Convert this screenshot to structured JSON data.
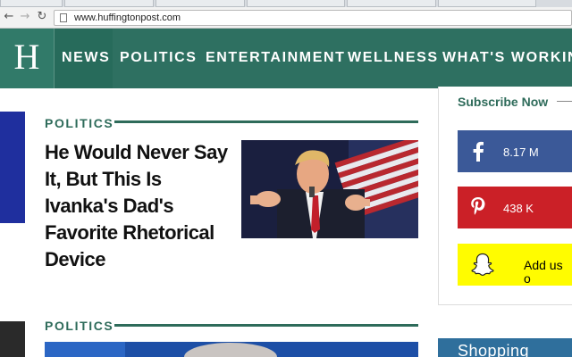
{
  "browser": {
    "url": "www.huffingtonpost.com",
    "back_icon": "arrow-left",
    "forward_icon": "arrow-right",
    "reload_icon": "reload"
  },
  "site": {
    "logo": "H",
    "nav": [
      "NEWS",
      "POLITICS",
      "ENTERTAINMENT",
      "WELLNESS",
      "WHAT'S WORKING"
    ],
    "brand_color": "#2e7061"
  },
  "main": {
    "story1": {
      "section": "POLITICS",
      "headline": "He Would Never Say It, But This Is Ivanka's Dad's Favorite Rhetorical Device"
    },
    "story2": {
      "section": "POLITICS"
    }
  },
  "sidebar": {
    "subscribe": "Subscribe Now",
    "facebook": {
      "count": "8.17 M",
      "icon": "facebook-icon",
      "color": "#3b5998"
    },
    "pinterest": {
      "count": "438 K",
      "icon": "pinterest-icon",
      "color": "#cb2027"
    },
    "snapchat": {
      "label": "Add us o",
      "icon": "snapchat-icon",
      "color": "#fffc00"
    },
    "shopping": "Shopping"
  }
}
